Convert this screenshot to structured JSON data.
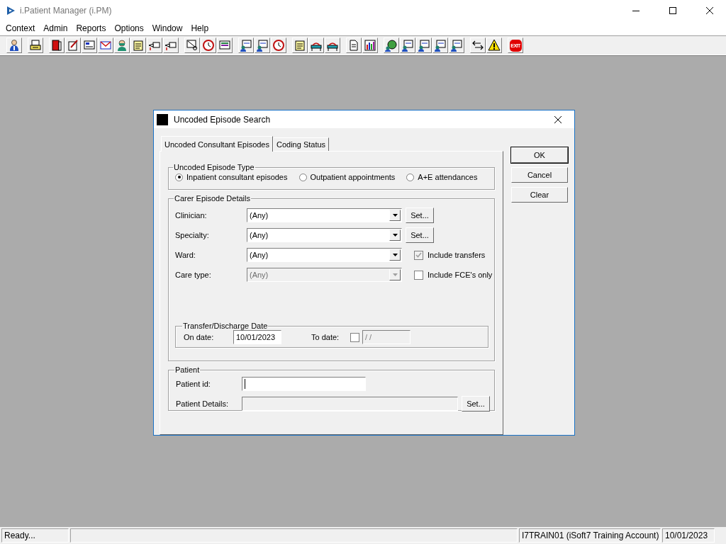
{
  "window": {
    "title": "i.Patient Manager (i.PM)"
  },
  "menu": [
    {
      "label": "Context"
    },
    {
      "label": "Admin"
    },
    {
      "label": "Reports"
    },
    {
      "label": "Options"
    },
    {
      "label": "Window"
    },
    {
      "label": "Help"
    }
  ],
  "toolbar": {
    "exit_label": "EXIT"
  },
  "dialog": {
    "title": "Uncoded Episode Search",
    "tabs": [
      {
        "label": "Uncoded Consultant Episodes",
        "selected": true
      },
      {
        "label": "Coding Status",
        "selected": false
      }
    ],
    "episode_type": {
      "title": "Uncoded Episode Type",
      "options": [
        {
          "label": "Inpatient consultant episodes",
          "selected": true
        },
        {
          "label": "Outpatient appointments",
          "selected": false
        },
        {
          "label": "A+E attendances",
          "selected": false
        }
      ]
    },
    "carer_details": {
      "title": "Carer Episode Details",
      "rows": [
        {
          "label": "Clinician:",
          "value": "(Any)",
          "disabled": false,
          "side": {
            "kind": "button",
            "label": "Set..."
          }
        },
        {
          "label": "Specialty:",
          "value": "(Any)",
          "disabled": false,
          "side": {
            "kind": "button",
            "label": "Set..."
          }
        },
        {
          "label": "Ward:",
          "value": "(Any)",
          "disabled": false,
          "side": {
            "kind": "checkbox",
            "label": "Include transfers",
            "checked": true,
            "disabled": true
          }
        },
        {
          "label": "Care type:",
          "value": "(Any)",
          "disabled": true,
          "side": {
            "kind": "checkbox",
            "label": "Include FCE's only",
            "checked": false,
            "disabled": false
          }
        }
      ]
    },
    "transfer_date": {
      "title": "Transfer/Discharge Date",
      "on_date_label": "On date:",
      "on_date": "10/01/2023",
      "to_date_label": "To date:",
      "to_date_checked": false,
      "to_date": "/ /"
    },
    "patient": {
      "title": "Patient",
      "id_label": "Patient id:",
      "id_focused": true,
      "details_label": "Patient Details:",
      "set_button": "Set..."
    },
    "buttons": [
      {
        "label": "OK",
        "default": true
      },
      {
        "label": "Cancel",
        "default": false
      },
      {
        "label": "Clear",
        "default": false
      }
    ]
  },
  "status_bar": {
    "message": "Ready...",
    "account": "I7TRAIN01 (iSoft7 Training Account)",
    "date": "10/01/2023"
  }
}
